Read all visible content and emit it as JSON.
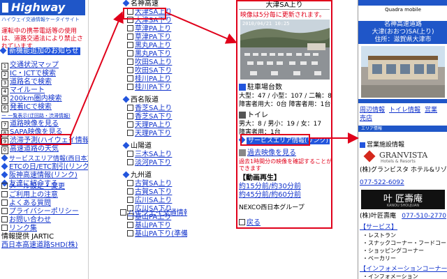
{
  "panel1": {
    "logo": "Highway",
    "subtitle": "ハイウェイ交通情報ケータイサイト",
    "warning": "運転中の携帯電話等の使用は、道路交通法により禁止されています",
    "notice": "新機能追加のお知らせ",
    "menu": [
      {
        "n": "1",
        "label": "交通状況マップ"
      },
      {
        "n": "2",
        "label": "IC・JCTで検索"
      },
      {
        "n": "3",
        "label": "道路名で検索"
      },
      {
        "n": "4",
        "label": "マイルート"
      },
      {
        "n": "5",
        "label": "200km圏内検索"
      },
      {
        "n": "6",
        "label": "発着ICで検索"
      },
      {
        "n": "",
        "label": "ー 一覧表示(迂回路・渋滞情報)"
      },
      {
        "n": "7",
        "label": "道路映像を見る"
      },
      {
        "n": "8",
        "label": "SAPA映像を見る"
      },
      {
        "n": "9",
        "label": "渋滞予測(ハイウェイ情報)"
      },
      {
        "n": "0",
        "label": "高速道路の天気"
      }
    ],
    "links": [
      "サービスエリア情報(西日本)",
      "ETCの日/ETC割引(リンク)",
      "阪神高速情報(リンク)",
      "友達に紹介する"
    ],
    "settings": [
      "メール設定・変更",
      "ご利用上の注意",
      "よくある質問",
      "プライバシーポリシー",
      "お問い合わせ",
      "リンク集"
    ],
    "footer_label": "情報提供 JARTIC",
    "footer_link": "西日本高速道路SHD(株)"
  },
  "panel2": {
    "groups": [
      {
        "title": "名神高速",
        "items": [
          "大津SA上り",
          "大津SA下り",
          "草津PA上り",
          "草津PA下り",
          "黒丸PA上り",
          "黒丸PA下り",
          "吹田SA上り",
          "吹田SA下り",
          "桂川PA上り",
          "桂川PA下り"
        ]
      },
      {
        "title": "西名阪道",
        "items": [
          "香芝SA上り",
          "香芝SA下り",
          "天理PA上り",
          "天理PA下り"
        ]
      },
      {
        "title": "山陽道",
        "items": [
          "三木SA上り",
          "淡河PA下り"
        ]
      },
      {
        "title": "九州道",
        "items": [
          "古賀SA上り",
          "古賀SA下り",
          "広川SA上り",
          "広川SA下り",
          "基山PA上り",
          "基山PA下り",
          "基山PA下り(準備中)"
        ]
      }
    ],
    "footer": "ハイウェイ交通情報TOP"
  },
  "panel3": {
    "title": "大津SA上り",
    "update_note": "映像は5分毎に更新されます。",
    "timestamp": "2010/04/21 10:25",
    "parking_title": "駐車場台数",
    "parking_line1": "大型：47 / 小型：107 / 二輪：8",
    "parking_line2": "障害者用大：0台 障害者用：1台",
    "toilet_title": "トイレ",
    "toilet_line1": "男大：8 / 男小：19 / 女：17",
    "toilet_line2": "障害者用：1台",
    "service_link": "サービスエリア情報(リンク)",
    "past_link": "過去映像を見る",
    "past_note": "過去1時間分の映像を確認することができます",
    "replay_title": "【動画再生】",
    "replay_rows": [
      "約15分前/約30分前",
      "約45分前/約60分前"
    ],
    "copyright": "NEXCO西日本グループ",
    "back": "戻る"
  },
  "panel4": {
    "brand": "Quadra mobile",
    "place_line1": "名神高速道路",
    "place_line2": "大津(おおつ)SA(上り)",
    "address": "住所：滋賀県大津市",
    "tabs": [
      "周辺情報",
      "トイレ情報",
      "営業",
      "売店"
    ],
    "area_label": "エリア情報",
    "facility_title": "営業施設情報",
    "hotel_logo": "GRANVISTA",
    "hotel_logo_sub": "Hotels & Resorts",
    "hotel_name": "(株)グランビスタ ホテル&リゾート",
    "hotel_phone": "077-522-6092",
    "shop_logo": "叶 匠壽庵",
    "shop_logo_sub": "KANOU SHOUJUAN",
    "shop_name": "(株)叶匠壽庵",
    "shop_phone": "077-510-2770",
    "service_head": "【サービス】",
    "services": [
      "・レストラン",
      "・スナックコーナー・フードコート",
      "・ショッピングコーナー",
      "・ベーカリー"
    ],
    "info_head": "【インフォメーションコーナー】",
    "info_items": [
      "・インフォメーション"
    ]
  }
}
